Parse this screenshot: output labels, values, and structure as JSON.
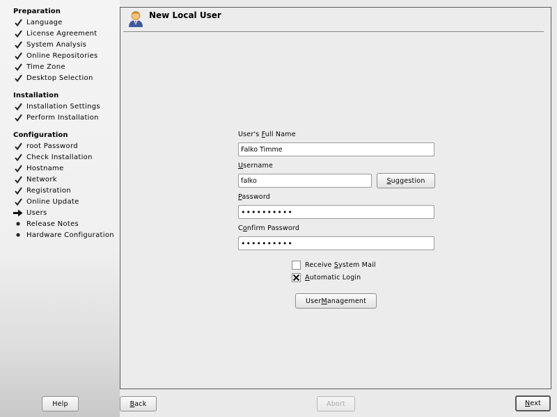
{
  "sidebar": {
    "sections": [
      {
        "title": "Preparation",
        "steps": [
          {
            "label": "Language",
            "state": "done"
          },
          {
            "label": "License Agreement",
            "state": "done"
          },
          {
            "label": "System Analysis",
            "state": "done"
          },
          {
            "label": "Online Repositories",
            "state": "done"
          },
          {
            "label": "Time Zone",
            "state": "done"
          },
          {
            "label": "Desktop Selection",
            "state": "done"
          }
        ]
      },
      {
        "title": "Installation",
        "steps": [
          {
            "label": "Installation Settings",
            "state": "done"
          },
          {
            "label": "Perform Installation",
            "state": "done"
          }
        ]
      },
      {
        "title": "Configuration",
        "steps": [
          {
            "label": "root Password",
            "state": "done"
          },
          {
            "label": "Check Installation",
            "state": "done"
          },
          {
            "label": "Hostname",
            "state": "done"
          },
          {
            "label": "Network",
            "state": "done"
          },
          {
            "label": "Registration",
            "state": "done"
          },
          {
            "label": "Online Update",
            "state": "done"
          },
          {
            "label": "Users",
            "state": "current"
          },
          {
            "label": "Release Notes",
            "state": "pending"
          },
          {
            "label": "Hardware Configuration",
            "state": "pending"
          }
        ]
      }
    ]
  },
  "header": {
    "title": "New Local User",
    "icon": "user-icon"
  },
  "form": {
    "full_name": {
      "label_pre": "User's ",
      "label_key": "F",
      "label_post": "ull Name",
      "value": "Falko Timme"
    },
    "username": {
      "label_pre": "",
      "label_key": "U",
      "label_post": "sername",
      "value": "falko"
    },
    "suggestion_button": {
      "label_pre": "",
      "label_key": "S",
      "label_post": "uggestion"
    },
    "password": {
      "label_pre": "",
      "label_key": "P",
      "label_post": "assword",
      "value": "••••••••••"
    },
    "confirm_password": {
      "label_pre": "C",
      "label_key": "o",
      "label_post": "nfirm Password",
      "value": "••••••••••"
    },
    "receive_mail": {
      "label_pre": "Receive ",
      "label_key": "S",
      "label_post": "ystem Mail",
      "checked": false
    },
    "auto_login": {
      "label_pre": "",
      "label_key": "A",
      "label_post": "utomatic Login",
      "checked": true
    },
    "user_management_button": {
      "label_pre": "User ",
      "label_key": "M",
      "label_post": "anagement"
    }
  },
  "footer": {
    "help": {
      "label": "Help"
    },
    "back": {
      "label_key": "B",
      "label_post": "ack"
    },
    "abort": {
      "label": "Abort"
    },
    "next": {
      "label_key": "N",
      "label_post": "ext"
    }
  }
}
